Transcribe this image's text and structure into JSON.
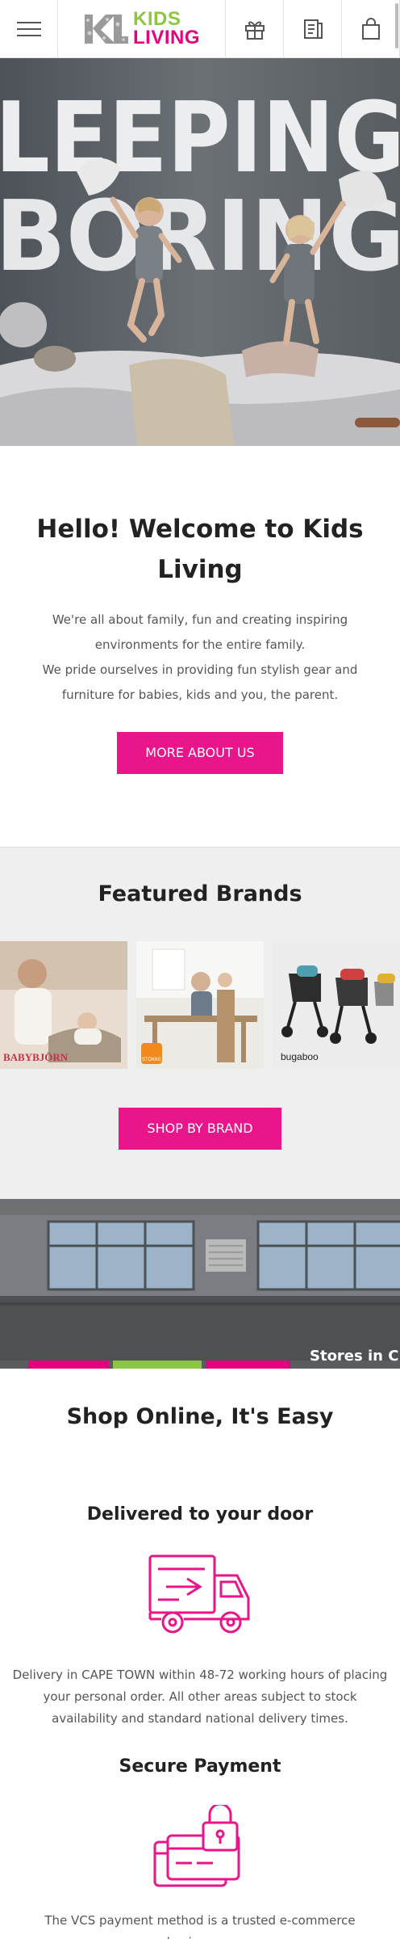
{
  "header": {
    "menu_icon": "hamburger-menu-icon",
    "logo": {
      "mark": "KL",
      "line1": "KIDS",
      "line2": "LIVING"
    },
    "icons": [
      "gift-icon",
      "wishlist-icon",
      "shopping-bag-icon"
    ]
  },
  "hero": {
    "line1": "LEEPING",
    "line2": "BORING"
  },
  "welcome": {
    "title": "Hello! Welcome to Kids Living",
    "paragraph1": "We're all about family, fun and creating inspiring environments for the entire family.",
    "paragraph2": "We pride ourselves in providing fun stylish gear and furniture for babies, kids and you, the parent.",
    "button": "MORE ABOUT US"
  },
  "brands": {
    "title": "Featured Brands",
    "items": [
      {
        "name": "BABYBJÖRN"
      },
      {
        "name": "STOKKE"
      },
      {
        "name": "bugaboo"
      }
    ],
    "button": "SHOP BY BRAND"
  },
  "store": {
    "caption": "Stores in C"
  },
  "shop": {
    "title": "Shop Online, It's Easy",
    "features": [
      {
        "title": "Delivered to your door",
        "icon": "delivery-truck-icon",
        "text": "Delivery in CAPE TOWN within 48-72 working hours of placing your personal order. All other areas subject to stock availability and standard national delivery times."
      },
      {
        "title": "Secure Payment",
        "icon": "secure-payment-icon",
        "text": "The VCS payment method is a trusted e-commerce businesses"
      }
    ]
  },
  "colors": {
    "brand_pink": "#e8168a",
    "brand_green": "#8dc63f",
    "brand_logo_pink": "#e6007e"
  }
}
